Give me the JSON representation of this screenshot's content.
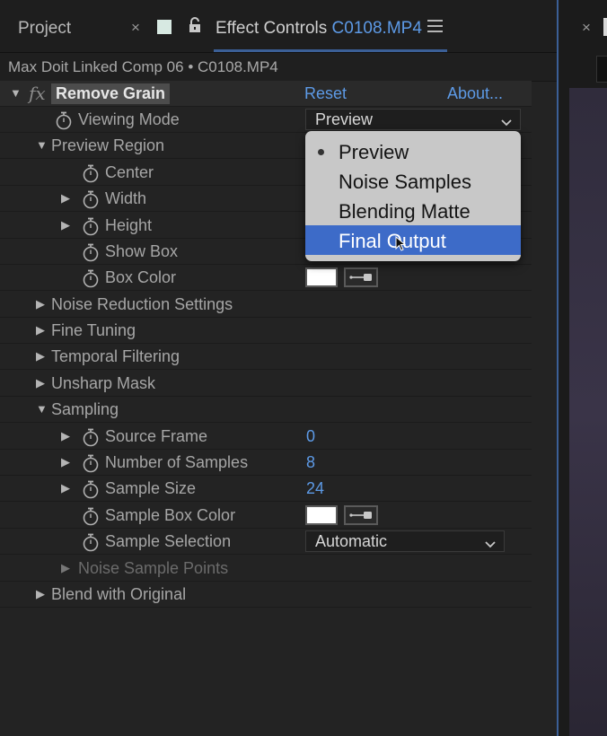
{
  "tabs": {
    "project": "Project",
    "close": "×",
    "effect_controls": "Effect Controls",
    "effect_controls_clip": "C0108.MP4"
  },
  "comp_path": "Max Doit Linked Comp 06 • C0108.MP4",
  "effect": {
    "fx_symbol": "fx",
    "name": "Remove Grain",
    "reset": "Reset",
    "about": "About..."
  },
  "properties": {
    "viewing_mode": {
      "label": "Viewing Mode",
      "value": "Preview"
    },
    "preview_region": "Preview Region",
    "center": "Center",
    "width": "Width",
    "height": "Height",
    "show_box": "Show Box",
    "box_color": {
      "label": "Box Color",
      "color": "#ffffff"
    },
    "noise_reduction": "Noise Reduction Settings",
    "fine_tuning": "Fine Tuning",
    "temporal_filtering": "Temporal Filtering",
    "unsharp_mask": "Unsharp Mask",
    "sampling": "Sampling",
    "source_frame": {
      "label": "Source Frame",
      "value": "0"
    },
    "number_of_samples": {
      "label": "Number of Samples",
      "value": "8"
    },
    "sample_size": {
      "label": "Sample Size",
      "value": "24"
    },
    "sample_box_color": {
      "label": "Sample Box Color",
      "color": "#ffffff"
    },
    "sample_selection": {
      "label": "Sample Selection",
      "value": "Automatic"
    },
    "noise_sample_points": "Noise Sample Points",
    "blend_with_original": "Blend with Original"
  },
  "dropdown": {
    "options": [
      "Preview",
      "Noise Samples",
      "Blending Matte",
      "Final Output"
    ],
    "checked": "Preview",
    "highlighted": "Final Output"
  },
  "right_panel": {
    "close": "×"
  },
  "colors": {
    "accent_blue": "#5d9ae6",
    "highlight": "#3d6bc8",
    "panel_border": "#3b5f96"
  }
}
